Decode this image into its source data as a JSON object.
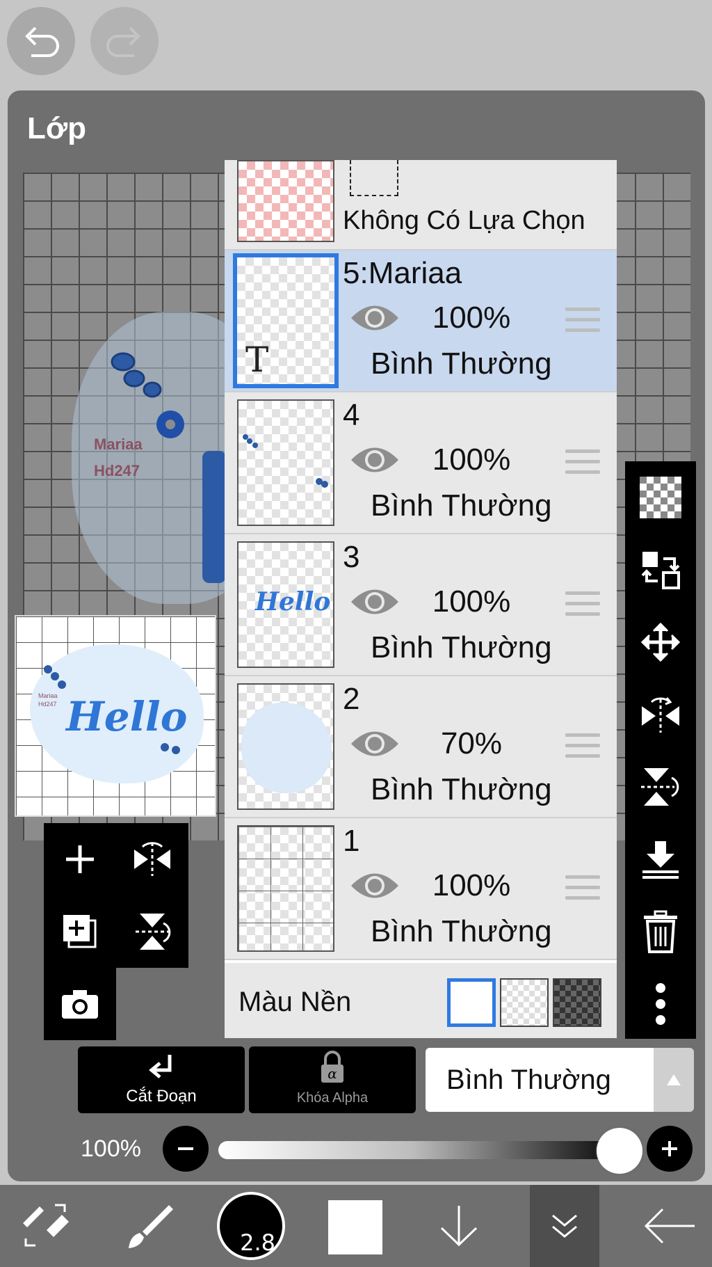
{
  "panel": {
    "title": "Lớp"
  },
  "canvas": {
    "text_line1": "Mariaa",
    "text_line2": "Hd247",
    "preview_text": "Hello",
    "preview_small1": "Mariaa",
    "preview_small2": "Hd247"
  },
  "layers": {
    "selection_layer": {
      "label": "Không Có Lựa Chọn"
    },
    "items": [
      {
        "name": "5:Mariaa",
        "opacity": "100%",
        "blend": "Bình Thường",
        "selected": true,
        "thumb_letter": "T"
      },
      {
        "name": "4",
        "opacity": "100%",
        "blend": "Bình Thường",
        "selected": false
      },
      {
        "name": "3",
        "opacity": "100%",
        "blend": "Bình Thường",
        "selected": false,
        "thumb_text": "Hello"
      },
      {
        "name": "2",
        "opacity": "70%",
        "blend": "Bình Thường",
        "selected": false
      },
      {
        "name": "1",
        "opacity": "100%",
        "blend": "Bình Thường",
        "selected": false
      }
    ],
    "background": {
      "label": "Màu Nền"
    }
  },
  "actions": {
    "clip_label": "Cắt Đoạn",
    "alpha_lock_label": "Khóa Alpha",
    "blend_mode": "Bình Thường"
  },
  "opacity": {
    "value_label": "100%",
    "value": 1.0
  },
  "brush": {
    "size": "2.8"
  },
  "colors": {
    "accent": "#2f7ae0",
    "selected_row": "#c8d8ee",
    "panel": "#6f6f6f"
  }
}
